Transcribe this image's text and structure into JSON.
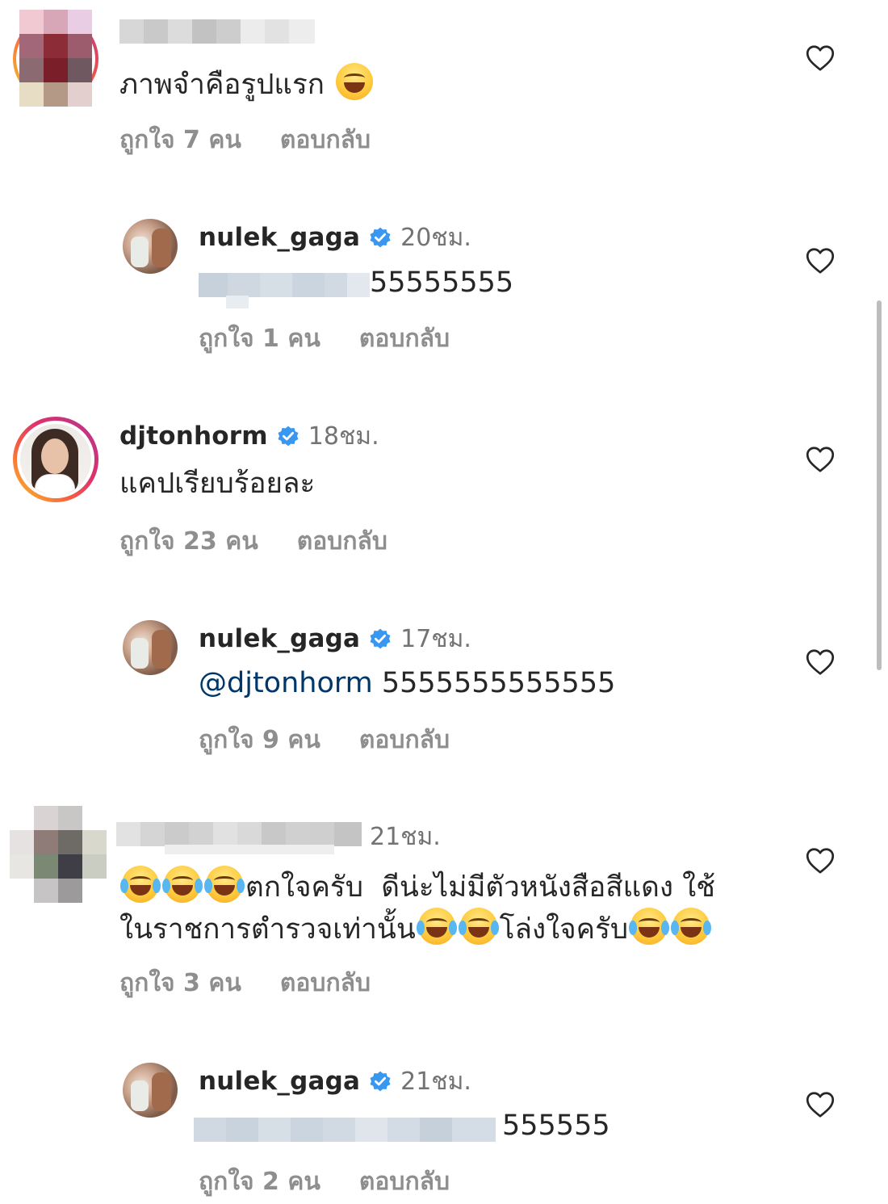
{
  "comments": [
    {
      "text": "ภาพจำคือรูปแรก",
      "emoji": "grinning-squinting-face",
      "likes_label": "ถูกใจ 7 คน",
      "reply_label": "ตอบกลับ"
    },
    {
      "username": "nulek_gaga",
      "time": "20ชม.",
      "text": "55555555",
      "likes_label": "ถูกใจ 1 คน",
      "reply_label": "ตอบกลับ"
    },
    {
      "username": "djtonhorm",
      "time": "18ชม.",
      "text": "แคปเรียบร้อยละ",
      "likes_label": "ถูกใจ 23 คน",
      "reply_label": "ตอบกลับ"
    },
    {
      "username": "nulek_gaga",
      "time": "17ชม.",
      "mention": "@djtonhorm",
      "text": "5555555555555",
      "likes_label": "ถูกใจ 9 คน",
      "reply_label": "ตอบกลับ"
    },
    {
      "time": "21ชม.",
      "line1_text": "ตกใจครับ  ดีน่ะไม่มีตัวหนังสือสีแดง ใช้",
      "line2_text_a": "ในราชการตำรวจเท่านั้น",
      "line2_text_b": "โล่งใจครับ",
      "emoji": "face-with-tears-of-joy",
      "likes_label": "ถูกใจ 3 คน",
      "reply_label": "ตอบกลับ"
    },
    {
      "username": "nulek_gaga",
      "time": "21ชม.",
      "text": "555555",
      "likes_label": "ถูกใจ 2 คน",
      "reply_label": "ตอบกลับ"
    }
  ],
  "icons": {
    "like": "heart-outline-icon",
    "verified": "verified-badge-icon"
  },
  "colors": {
    "text": "#262626",
    "secondary": "#8e8e8e",
    "mention": "#00376b",
    "verified": "#3897f0",
    "story_ring_start": "#f9c52a",
    "story_ring_end": "#833ab4"
  }
}
